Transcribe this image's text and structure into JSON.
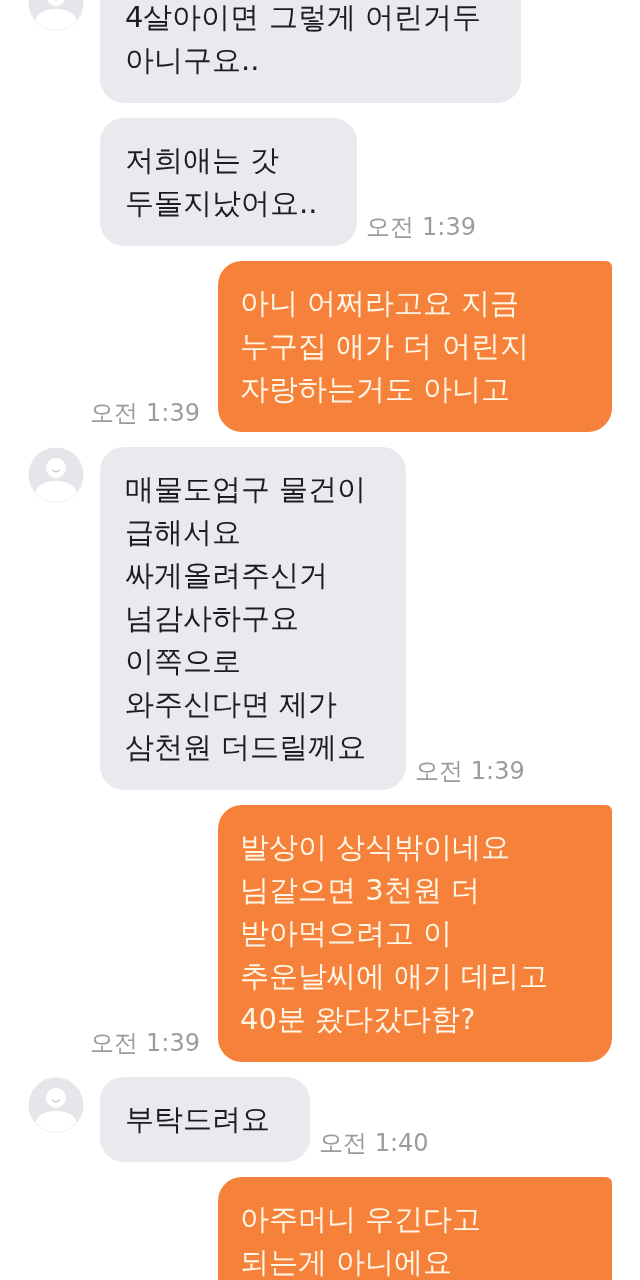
{
  "messages": [
    {
      "kind": "received",
      "avatar": true,
      "text": "4살아이면 그렇게 어린거두\n아니구요.."
    },
    {
      "kind": "received",
      "avatar": false,
      "text": "저희애는 갓\n두돌지났어요..",
      "time": "오전 1:39"
    },
    {
      "kind": "sent",
      "text": "아니 어쩌라고요 지금\n누구집 애가 더 어린지\n자랑하는거도 아니고",
      "time": "오전 1:39"
    },
    {
      "kind": "received",
      "avatar": true,
      "text": "매물도업구 물건이\n급해서요\n싸게올려주신거\n넘감사하구요\n이쪽으로\n와주신다면 제가\n삼천원 더드릴께요",
      "time": "오전 1:39"
    },
    {
      "kind": "sent",
      "text": "발상이 상식밖이네요\n님같으면 3천원 더\n받아먹으려고 이\n추운날씨에 애기 데리고\n40분 왔다갔다함?",
      "time": "오전 1:39"
    },
    {
      "kind": "received",
      "avatar": true,
      "text": "부탁드려요",
      "time": "오전 1:40"
    },
    {
      "kind": "sent",
      "text": "아주머니 우긴다고\n되는게 아니에요"
    }
  ]
}
